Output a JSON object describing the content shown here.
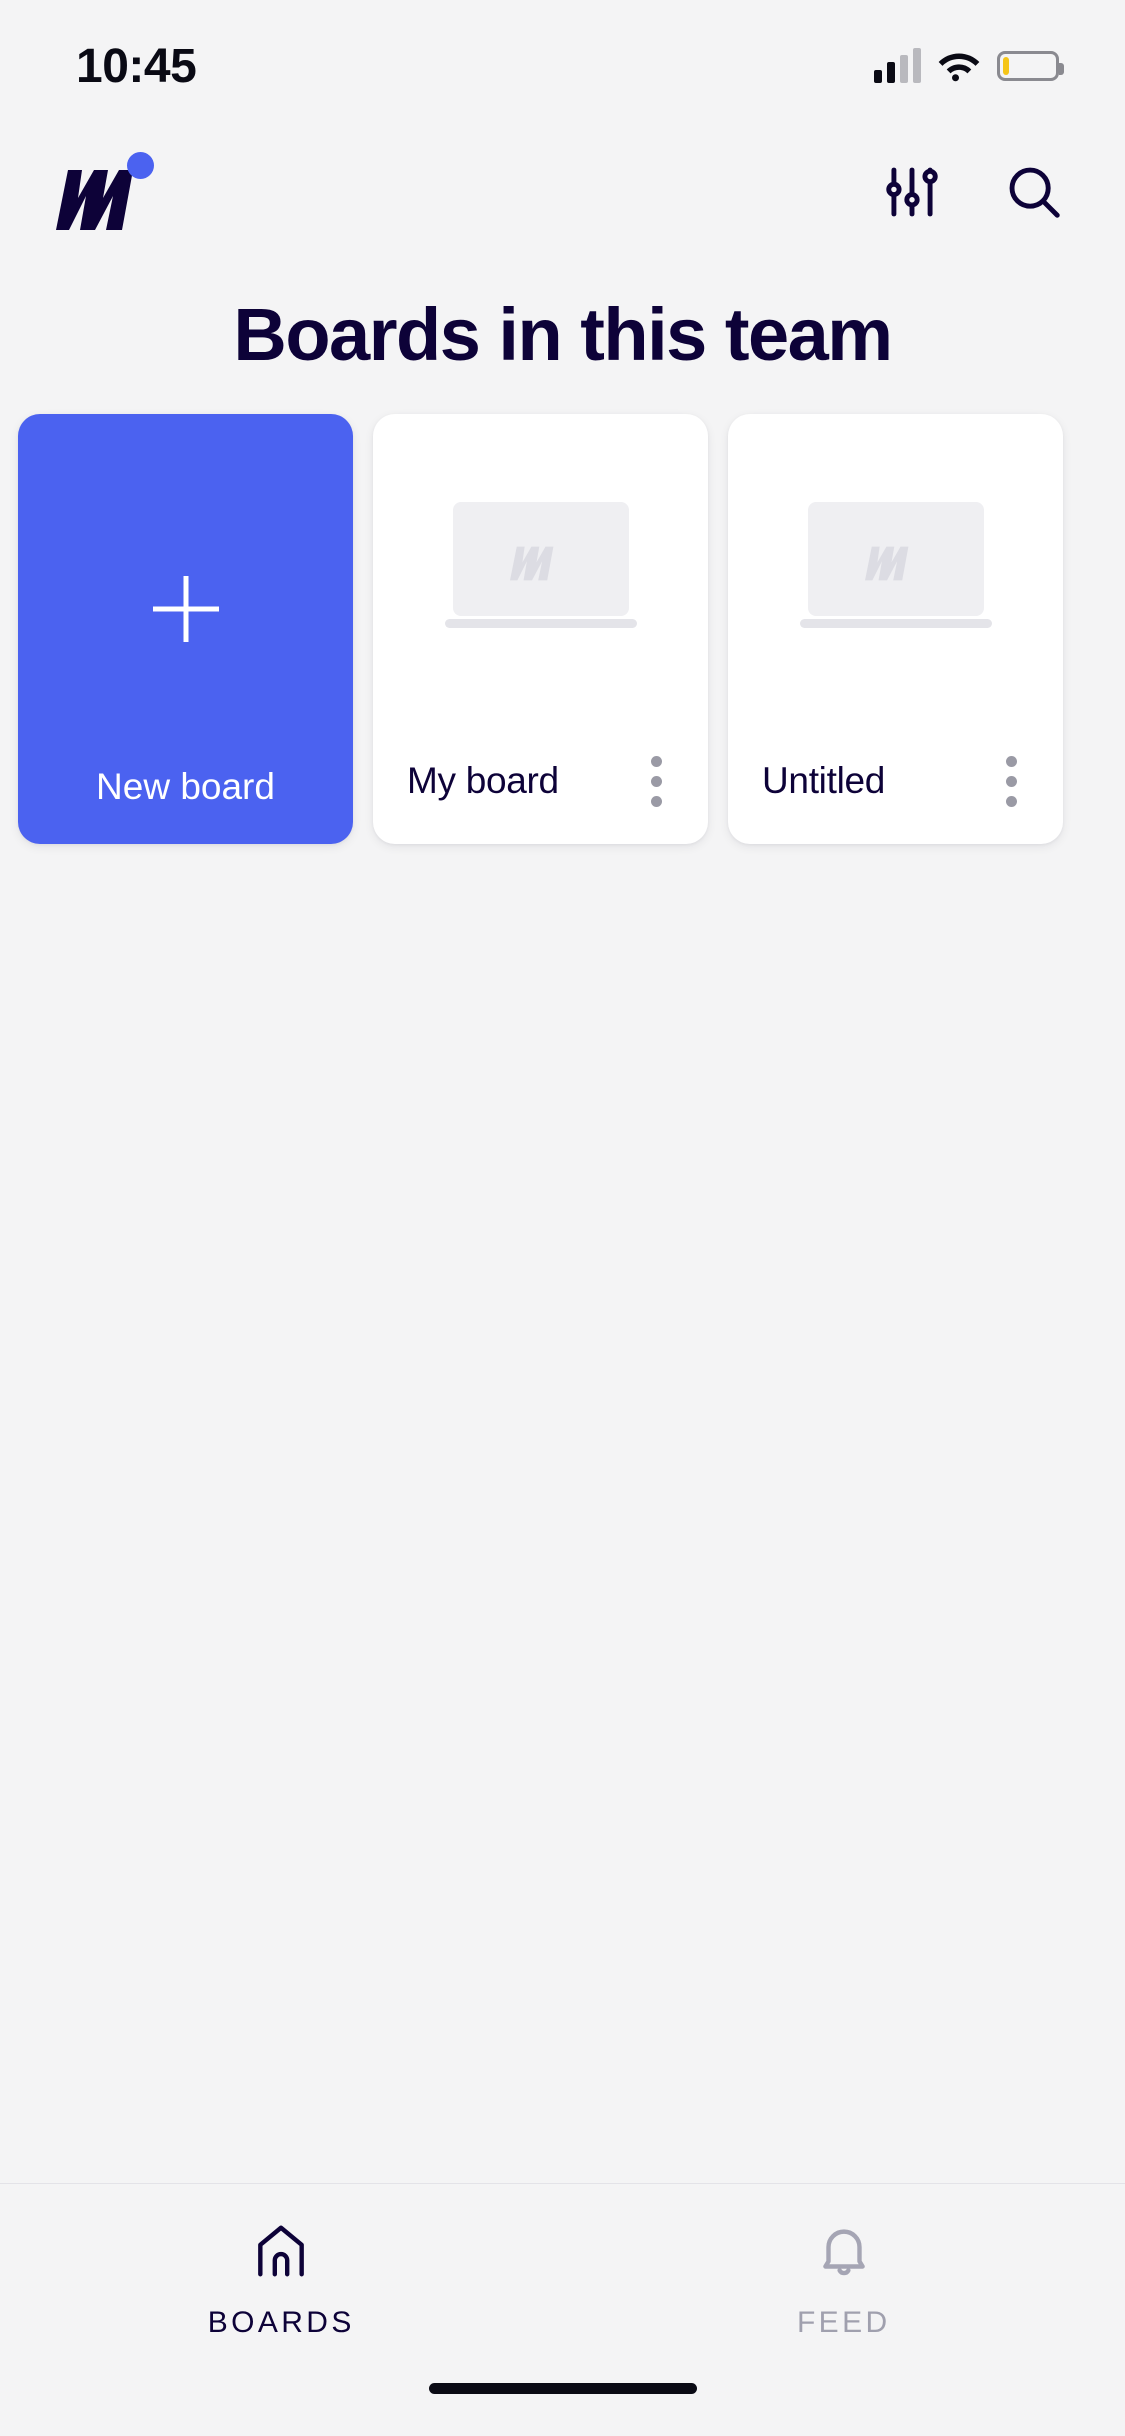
{
  "status_bar": {
    "time": "10:45",
    "cellular_icon": "cellular-signal-icon",
    "wifi_icon": "wifi-icon",
    "battery_icon": "battery-low-icon",
    "battery_level_percent": 12,
    "battery_color": "#F5C518"
  },
  "header": {
    "logo_name": "miro-logo",
    "logo_color": "#0D0238",
    "logo_dot_color": "#4B62F0",
    "actions": [
      {
        "name": "filter-icon",
        "label": "Filter"
      },
      {
        "name": "search-icon",
        "label": "Search"
      }
    ]
  },
  "page": {
    "title": "Boards in this team",
    "title_color": "#0D0238",
    "background_color": "#F4F4F5"
  },
  "boards": {
    "new_board": {
      "label": "New board",
      "icon": "plus-icon",
      "background_color": "#4B62F0",
      "text_color": "#FFFFFF"
    },
    "items": [
      {
        "title": "My board",
        "thumbnail": "miro-placeholder-thumbnail",
        "menu_icon": "kebab-menu-icon"
      },
      {
        "title": "Untitled",
        "thumbnail": "miro-placeholder-thumbnail",
        "menu_icon": "kebab-menu-icon"
      }
    ]
  },
  "tab_bar": {
    "tabs": [
      {
        "label": "BOARDS",
        "icon": "home-icon",
        "active": true,
        "color": "#0D0238"
      },
      {
        "label": "FEED",
        "icon": "bell-icon",
        "active": false,
        "color": "#A0A0AE"
      }
    ]
  },
  "home_indicator": {
    "name": "home-indicator-bar"
  }
}
